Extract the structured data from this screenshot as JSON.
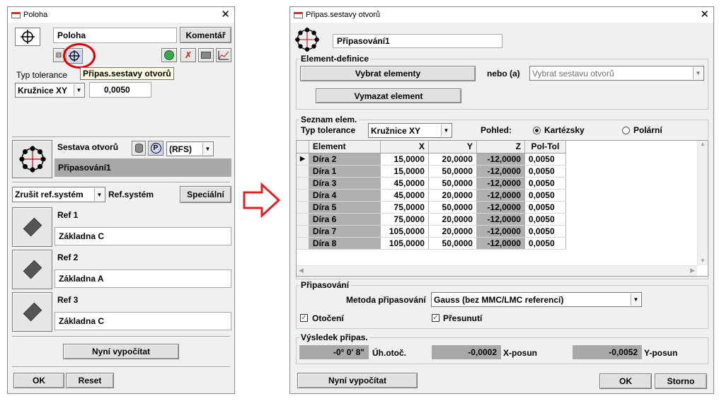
{
  "left": {
    "title": "Poloha",
    "name_value": "Poloha",
    "comment_button": "Komentář",
    "tooltip": "Připas.sestavy otvorů",
    "tolerance_label": "Typ tolerance",
    "tolerance_type": "Kružnice XY",
    "tolerance_value": "0,0050",
    "pattern_label": "Sestava otvorů",
    "rfs_value": "(RFS)",
    "pattern_value": "Připasování1",
    "ref_combo": "Zrušit ref.systém",
    "ref_system_label": "Ref.systém",
    "special_button": "Speciální",
    "refs": [
      {
        "label": "Ref 1",
        "value": "Základna C"
      },
      {
        "label": "Ref 2",
        "value": "Základna A"
      },
      {
        "label": "Ref 3",
        "value": "Základna C"
      }
    ],
    "compute_button": "Nyní vypočítat",
    "ok_button": "OK",
    "reset_button": "Reset"
  },
  "right": {
    "title": "Připas.sestavy otvorů",
    "name_value": "Připasování1",
    "element_def_group": "Element-definice",
    "select_elements_button": "Vybrat elementy",
    "or_label": "nebo (a)",
    "select_pattern_placeholder": "Vybrat sestavu otvorů",
    "delete_element_button": "Vymazat element",
    "list_group": "Seznam elem.",
    "tolerance_label": "Typ tolerance",
    "tolerance_type": "Kružnice XY",
    "view_label": "Pohled:",
    "cartesian_label": "Kartézsky",
    "polar_label": "Polární",
    "columns": [
      "Element",
      "X",
      "Y",
      "Z",
      "Pol-Tol"
    ],
    "rows": [
      [
        "Díra 2",
        "15,0000",
        "20,0000",
        "-12,0000",
        "0,0050"
      ],
      [
        "Díra 1",
        "15,0000",
        "50,0000",
        "-12,0000",
        "0,0050"
      ],
      [
        "Díra 3",
        "45,0000",
        "50,0000",
        "-12,0000",
        "0,0050"
      ],
      [
        "Díra 4",
        "45,0000",
        "20,0000",
        "-12,0000",
        "0,0050"
      ],
      [
        "Díra 5",
        "75,0000",
        "50,0000",
        "-12,0000",
        "0,0050"
      ],
      [
        "Díra 6",
        "75,0000",
        "20,0000",
        "-12,0000",
        "0,0050"
      ],
      [
        "Díra 7",
        "105,0000",
        "20,0000",
        "-12,0000",
        "0,0050"
      ],
      [
        "Díra 8",
        "105,0000",
        "50,0000",
        "-12,0000",
        "0,0050"
      ]
    ],
    "fit_group": "Připasování",
    "fit_method_label": "Metoda připasování",
    "fit_method_value": "Gauss  (bez MMC/LMC referencí)",
    "rotation_label": "Otočení",
    "translation_label": "Přesunutí",
    "result_group": "Výsledek připas.",
    "result_angle": "-0° 0' 8\"",
    "result_angle_label": "Úh.otoč.",
    "result_x": "-0,0002",
    "result_x_label": "X-posun",
    "result_y": "-0,0052",
    "result_y_label": "Y-posun",
    "compute_button": "Nyní vypočítat",
    "ok_button": "OK",
    "cancel_button": "Storno"
  },
  "colors": {
    "arrow": "#e02020",
    "highlight_circle": "#e00000",
    "tooltip_bg": "#ffffe1",
    "pattern_bar": "#a8a8a8",
    "gray_cell": "#b0b0b0"
  }
}
